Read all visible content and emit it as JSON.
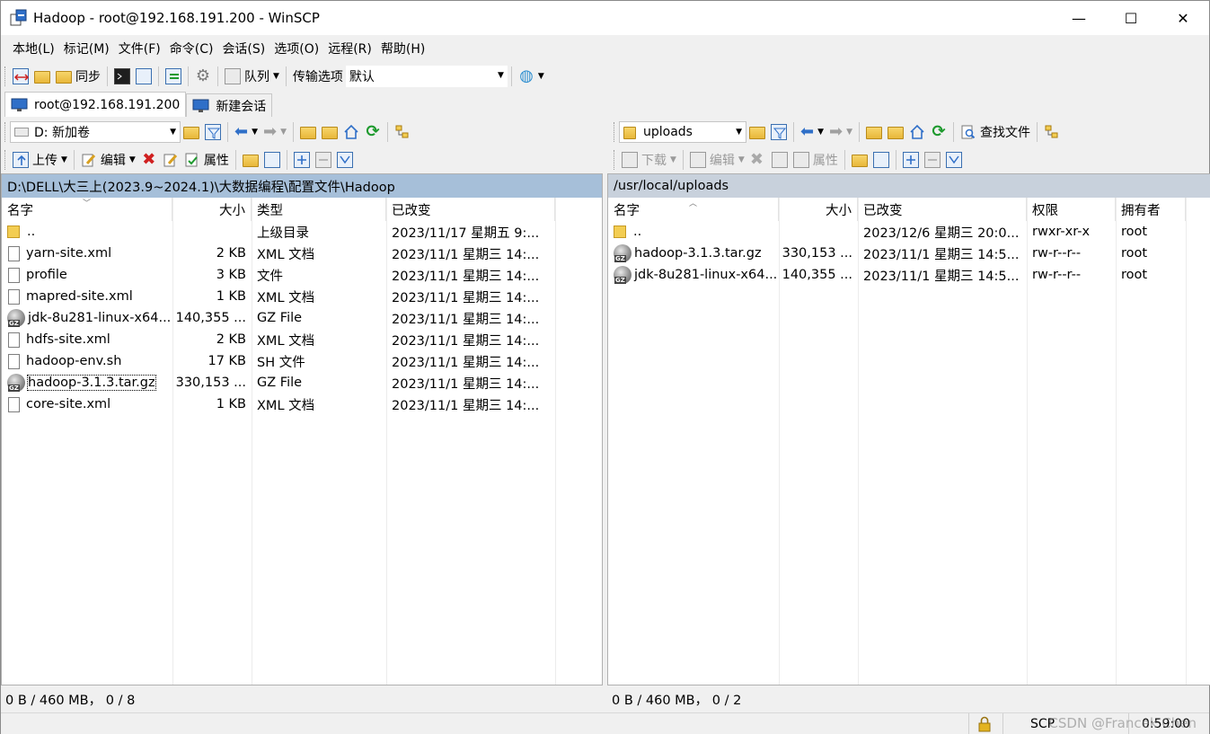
{
  "window": {
    "title": "Hadoop - root@192.168.191.200 - WinSCP",
    "minimize": "—",
    "maximize": "☐",
    "close": "✕"
  },
  "menu": [
    "本地(L)",
    "标记(M)",
    "文件(F)",
    "命令(C)",
    "会话(S)",
    "选项(O)",
    "远程(R)",
    "帮助(H)"
  ],
  "toolbar": {
    "sync_label": "同步",
    "queue_label": "队列",
    "transfer_options_label": "传输选项",
    "transfer_preset": "默认"
  },
  "tabs": {
    "session": "root@192.168.191.200",
    "new_session": "新建会话"
  },
  "left_toolbar": {
    "drive": "D: 新加卷",
    "upload": "上传",
    "edit": "编辑",
    "properties": "属性"
  },
  "right_toolbar": {
    "folder": "uploads",
    "find_files": "查找文件",
    "download": "下载",
    "edit": "编辑",
    "properties": "属性"
  },
  "left_panel": {
    "path": "D:\\DELL\\大三上(2023.9~2024.1)\\大数据编程\\配置文件\\Hadoop",
    "columns": [
      "名字",
      "大小",
      "类型",
      "已改变"
    ],
    "rows": [
      {
        "name": "..",
        "size": "",
        "type": "上级目录",
        "modified": "2023/11/17 星期五  9:...",
        "icon": "parent"
      },
      {
        "name": "yarn-site.xml",
        "size": "2 KB",
        "type": "XML 文档",
        "modified": "2023/11/1 星期三  14:...",
        "icon": "file"
      },
      {
        "name": "profile",
        "size": "3 KB",
        "type": "文件",
        "modified": "2023/11/1 星期三  14:...",
        "icon": "file"
      },
      {
        "name": "mapred-site.xml",
        "size": "1 KB",
        "type": "XML 文档",
        "modified": "2023/11/1 星期三  14:...",
        "icon": "file"
      },
      {
        "name": "jdk-8u281-linux-x64...",
        "size": "140,355 ...",
        "type": "GZ File",
        "modified": "2023/11/1 星期三  14:...",
        "icon": "gz"
      },
      {
        "name": "hdfs-site.xml",
        "size": "2 KB",
        "type": "XML 文档",
        "modified": "2023/11/1 星期三  14:...",
        "icon": "file"
      },
      {
        "name": "hadoop-env.sh",
        "size": "17 KB",
        "type": "SH 文件",
        "modified": "2023/11/1 星期三  14:...",
        "icon": "file"
      },
      {
        "name": "hadoop-3.1.3.tar.gz",
        "size": "330,153 ...",
        "type": "GZ File",
        "modified": "2023/11/1 星期三  14:...",
        "icon": "gz",
        "focused": true
      },
      {
        "name": "core-site.xml",
        "size": "1 KB",
        "type": "XML 文档",
        "modified": "2023/11/1 星期三  14:...",
        "icon": "file"
      }
    ],
    "status": "0 B / 460 MB，  0 / 8"
  },
  "right_panel": {
    "path": "/usr/local/uploads",
    "columns": [
      "名字",
      "大小",
      "已改变",
      "权限",
      "拥有者"
    ],
    "rows": [
      {
        "name": "..",
        "size": "",
        "modified": "2023/12/6 星期三 20:0...",
        "rights": "rwxr-xr-x",
        "owner": "root",
        "icon": "parent"
      },
      {
        "name": "hadoop-3.1.3.tar.gz",
        "size": "330,153 ...",
        "modified": "2023/11/1 星期三 14:5...",
        "rights": "rw-r--r--",
        "owner": "root",
        "icon": "gz"
      },
      {
        "name": "jdk-8u281-linux-x64...",
        "size": "140,355 ...",
        "modified": "2023/11/1 星期三 14:5...",
        "rights": "rw-r--r--",
        "owner": "root",
        "icon": "gz"
      }
    ],
    "status": "0 B / 460 MB，  0 / 2"
  },
  "statusbar": {
    "protocol": "SCP",
    "elapsed": "0:59:00",
    "watermark": "CSDN @Francek Chen"
  }
}
